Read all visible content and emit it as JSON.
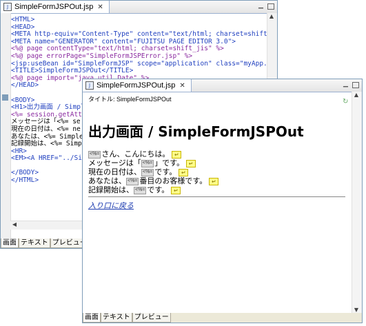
{
  "editor": {
    "tab_label": "SimpleFormJSPOut.jsp",
    "code_lines": [
      "<HTML>",
      "<HEAD>",
      "<META http-equiv=\"Content-Type\" content=\"text/html; charset=shift_jis\">",
      "<META name=\"GENERATOR\" content=\"FUJITSU PAGE EDITOR 3.0\">",
      "<%@ page contentType=\"text/html; charset=shift_jis\" %>",
      "<%@ page errorPage=\"SimpleFormJSPError.jsp\" %>",
      "<jsp:useBean id=\"SimpleFormJSP\" scope=\"application\" class=\"myApp.Counter",
      "<TITLE>SimpleFormJSPOut</TITLE>",
      "<%@ page import=\"java.util.Date\" %>",
      "</HEAD>",
      "",
      "<BODY>",
      "<H1>出力画面 / Simpl",
      "<%= session.getAttri",
      "メッセージは「<%= se",
      "現在の日付は、<%= ne",
      "あなたは、<%= Simple",
      "記録開始は、<%= Simp",
      "<HR>",
      "<EM><A HREF=\"../Simp",
      "",
      "</BODY>",
      "</HTML>"
    ],
    "bottom_tabs": [
      "画面",
      "テキスト",
      "プレビュー"
    ]
  },
  "preview": {
    "tab_label": "SimpleFormJSPOut.jsp",
    "title_line": "タイトル: SimpleFormJSPOut",
    "heading": "出力画面 / SimpleFormJSPOut",
    "placeholder_label": "<%=",
    "lines": [
      {
        "before": "",
        "after": "さん、こんにちは。"
      },
      {
        "before": "メッセージは「",
        "after": "」です。"
      },
      {
        "before": "現在の日付は、",
        "after": "です。"
      },
      {
        "before": "あなたは、",
        "after": "番目のお客様です。"
      },
      {
        "before": "記録開始は、",
        "after": "です。"
      }
    ],
    "link_text": "入り口に戻る",
    "bottom_tabs": [
      "画面",
      "テキスト",
      "プレビュー"
    ]
  }
}
